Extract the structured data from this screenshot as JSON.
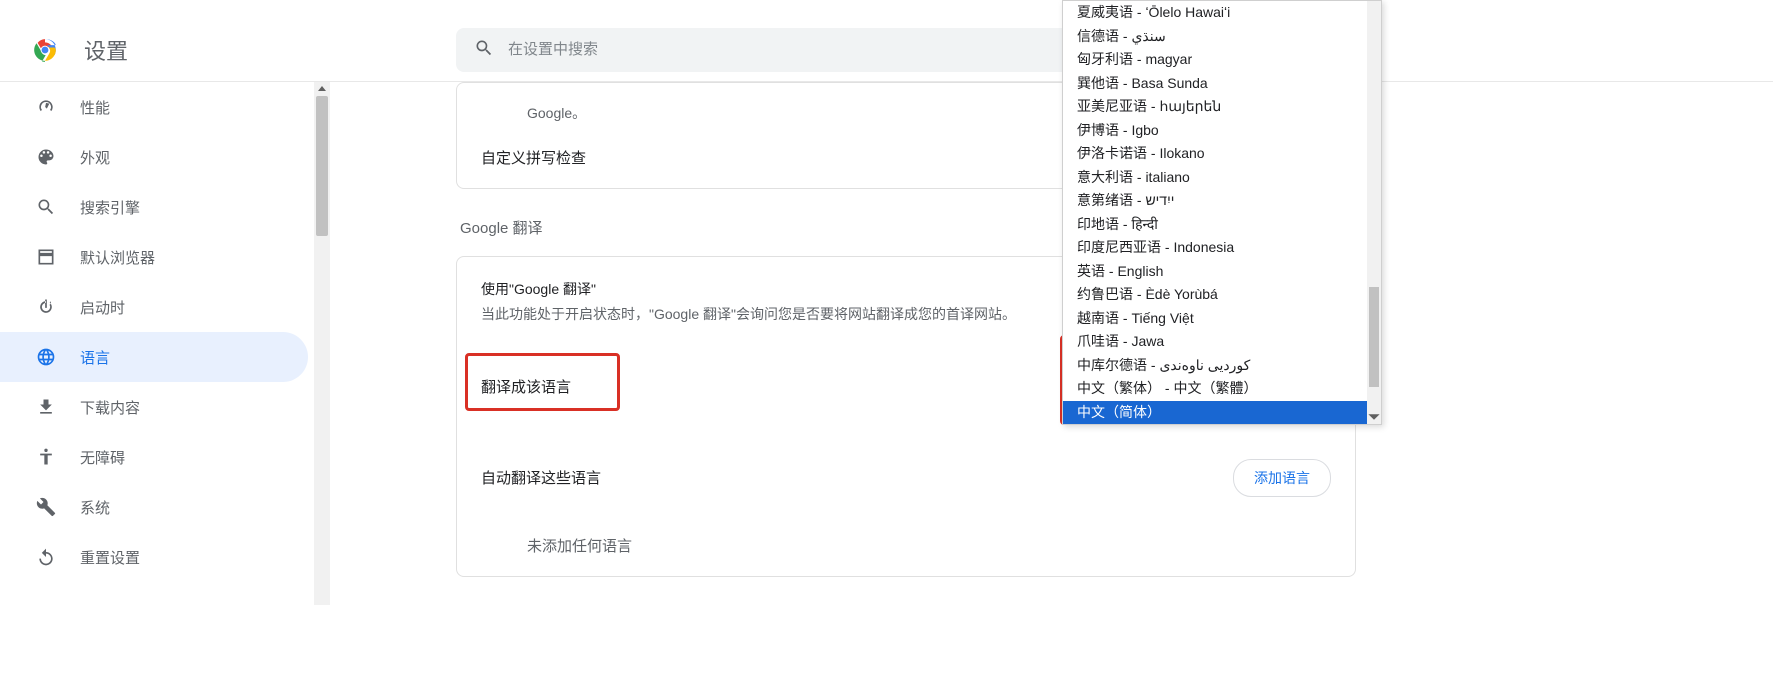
{
  "header": {
    "title": "设置",
    "search_placeholder": "在设置中搜索"
  },
  "sidebar": {
    "items": [
      {
        "label": "性能",
        "icon": "speedometer"
      },
      {
        "label": "外观",
        "icon": "palette"
      },
      {
        "label": "搜索引擎",
        "icon": "search"
      },
      {
        "label": "默认浏览器",
        "icon": "browser"
      },
      {
        "label": "启动时",
        "icon": "power"
      },
      {
        "label": "语言",
        "icon": "globe",
        "selected": true
      },
      {
        "label": "下载内容",
        "icon": "download"
      },
      {
        "label": "无障碍",
        "icon": "accessibility"
      },
      {
        "label": "系统",
        "icon": "wrench"
      },
      {
        "label": "重置设置",
        "icon": "reset"
      }
    ]
  },
  "main": {
    "spell_desc": "Google。",
    "spell_custom": "自定义拼写检查",
    "translate_section": "Google 翻译",
    "use_translate_title": "使用\"Google 翻译\"",
    "use_translate_desc": "当此功能处于开启状态时，\"Google 翻译\"会询问您是否要将网站翻译成您的首译网站。",
    "translate_to_label": "翻译成该语言",
    "selected_lang": "中文（简体）",
    "auto_translate_label": "自动翻译这些语言",
    "add_lang_btn": "添加语言",
    "no_lang_text": "未添加任何语言"
  },
  "dropdown": {
    "items": [
      "夏威夷语 - ʻŌlelo Hawaiʻi",
      "信德语 - سنڌي",
      "匈牙利语 - magyar",
      "巽他语 - Basa Sunda",
      "亚美尼亚语 - հայերեն",
      "伊博语 - Igbo",
      "伊洛卡诺语 - Ilokano",
      "意大利语 - italiano",
      "意第绪语 - ייִדיש",
      "印地语 - हिन्दी",
      "印度尼西亚语 - Indonesia",
      "英语 - English",
      "约鲁巴语 - Èdè Yorùbá",
      "越南语 - Tiếng Việt",
      "爪哇语 - Jawa",
      "中库尔德语 - کوردیی ناوەندی",
      "中文（繁体） - 中文（繁體）",
      "中文（简体）"
    ],
    "selected_index": 17
  }
}
